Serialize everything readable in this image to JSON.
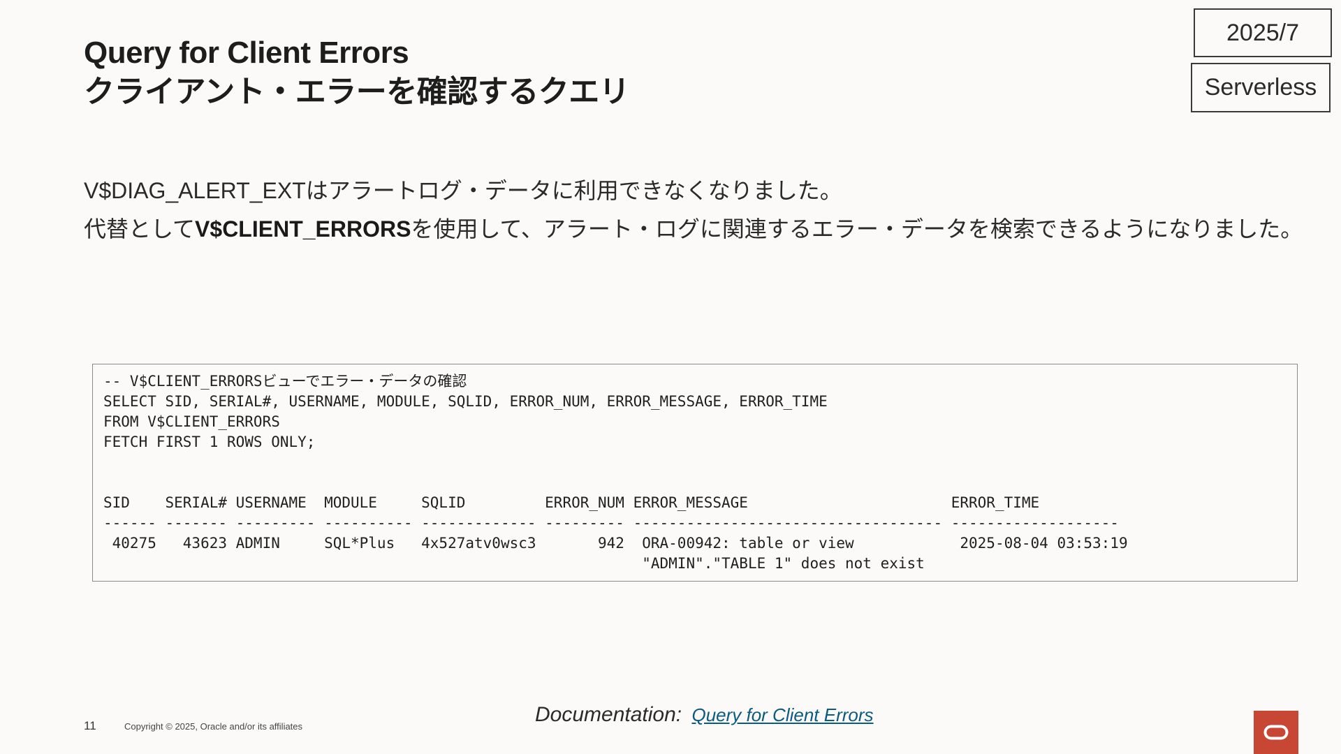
{
  "header": {
    "title_en": "Query for Client Errors",
    "title_ja": "クライアント・エラーを確認するクエリ",
    "date_badge": "2025/7",
    "service_badge": "Serverless"
  },
  "description": {
    "line1": "V$DIAG_ALERT_EXTはアラートログ・データに利用できなくなりました。",
    "line2_prefix": "代替として",
    "line2_bold": "V$CLIENT_ERRORS",
    "line2_suffix": "を使用して、アラート・ログに関連するエラー・データを検索できるようになりました。"
  },
  "code": {
    "lines": [
      "-- V$CLIENT_ERRORSビューでエラー・データの確認",
      "SELECT SID, SERIAL#, USERNAME, MODULE, SQLID, ERROR_NUM, ERROR_MESSAGE, ERROR_TIME",
      "FROM V$CLIENT_ERRORS",
      "FETCH FIRST 1 ROWS ONLY;",
      "",
      "",
      "SID    SERIAL# USERNAME  MODULE     SQLID         ERROR_NUM ERROR_MESSAGE                       ERROR_TIME",
      "------ ------- --------- ---------- ------------- --------- ----------------------------------- -------------------",
      " 40275   43623 ADMIN     SQL*Plus   4x527atv0wsc3       942  ORA-00942: table or view            2025-08-04 03:53:19",
      "                                                             \"ADMIN\".\"TABLE 1\" does not exist"
    ]
  },
  "footer": {
    "page_number": "11",
    "copyright": "Copyright © 2025, Oracle and/or its affiliates",
    "doc_label": "Documentation:",
    "doc_link": "Query for Client Errors"
  },
  "colors": {
    "background": "#fbfaf8",
    "link": "#0b5a80",
    "oracle_red": "#c74634"
  },
  "icons": {
    "brand": "oracle-logo-icon"
  }
}
